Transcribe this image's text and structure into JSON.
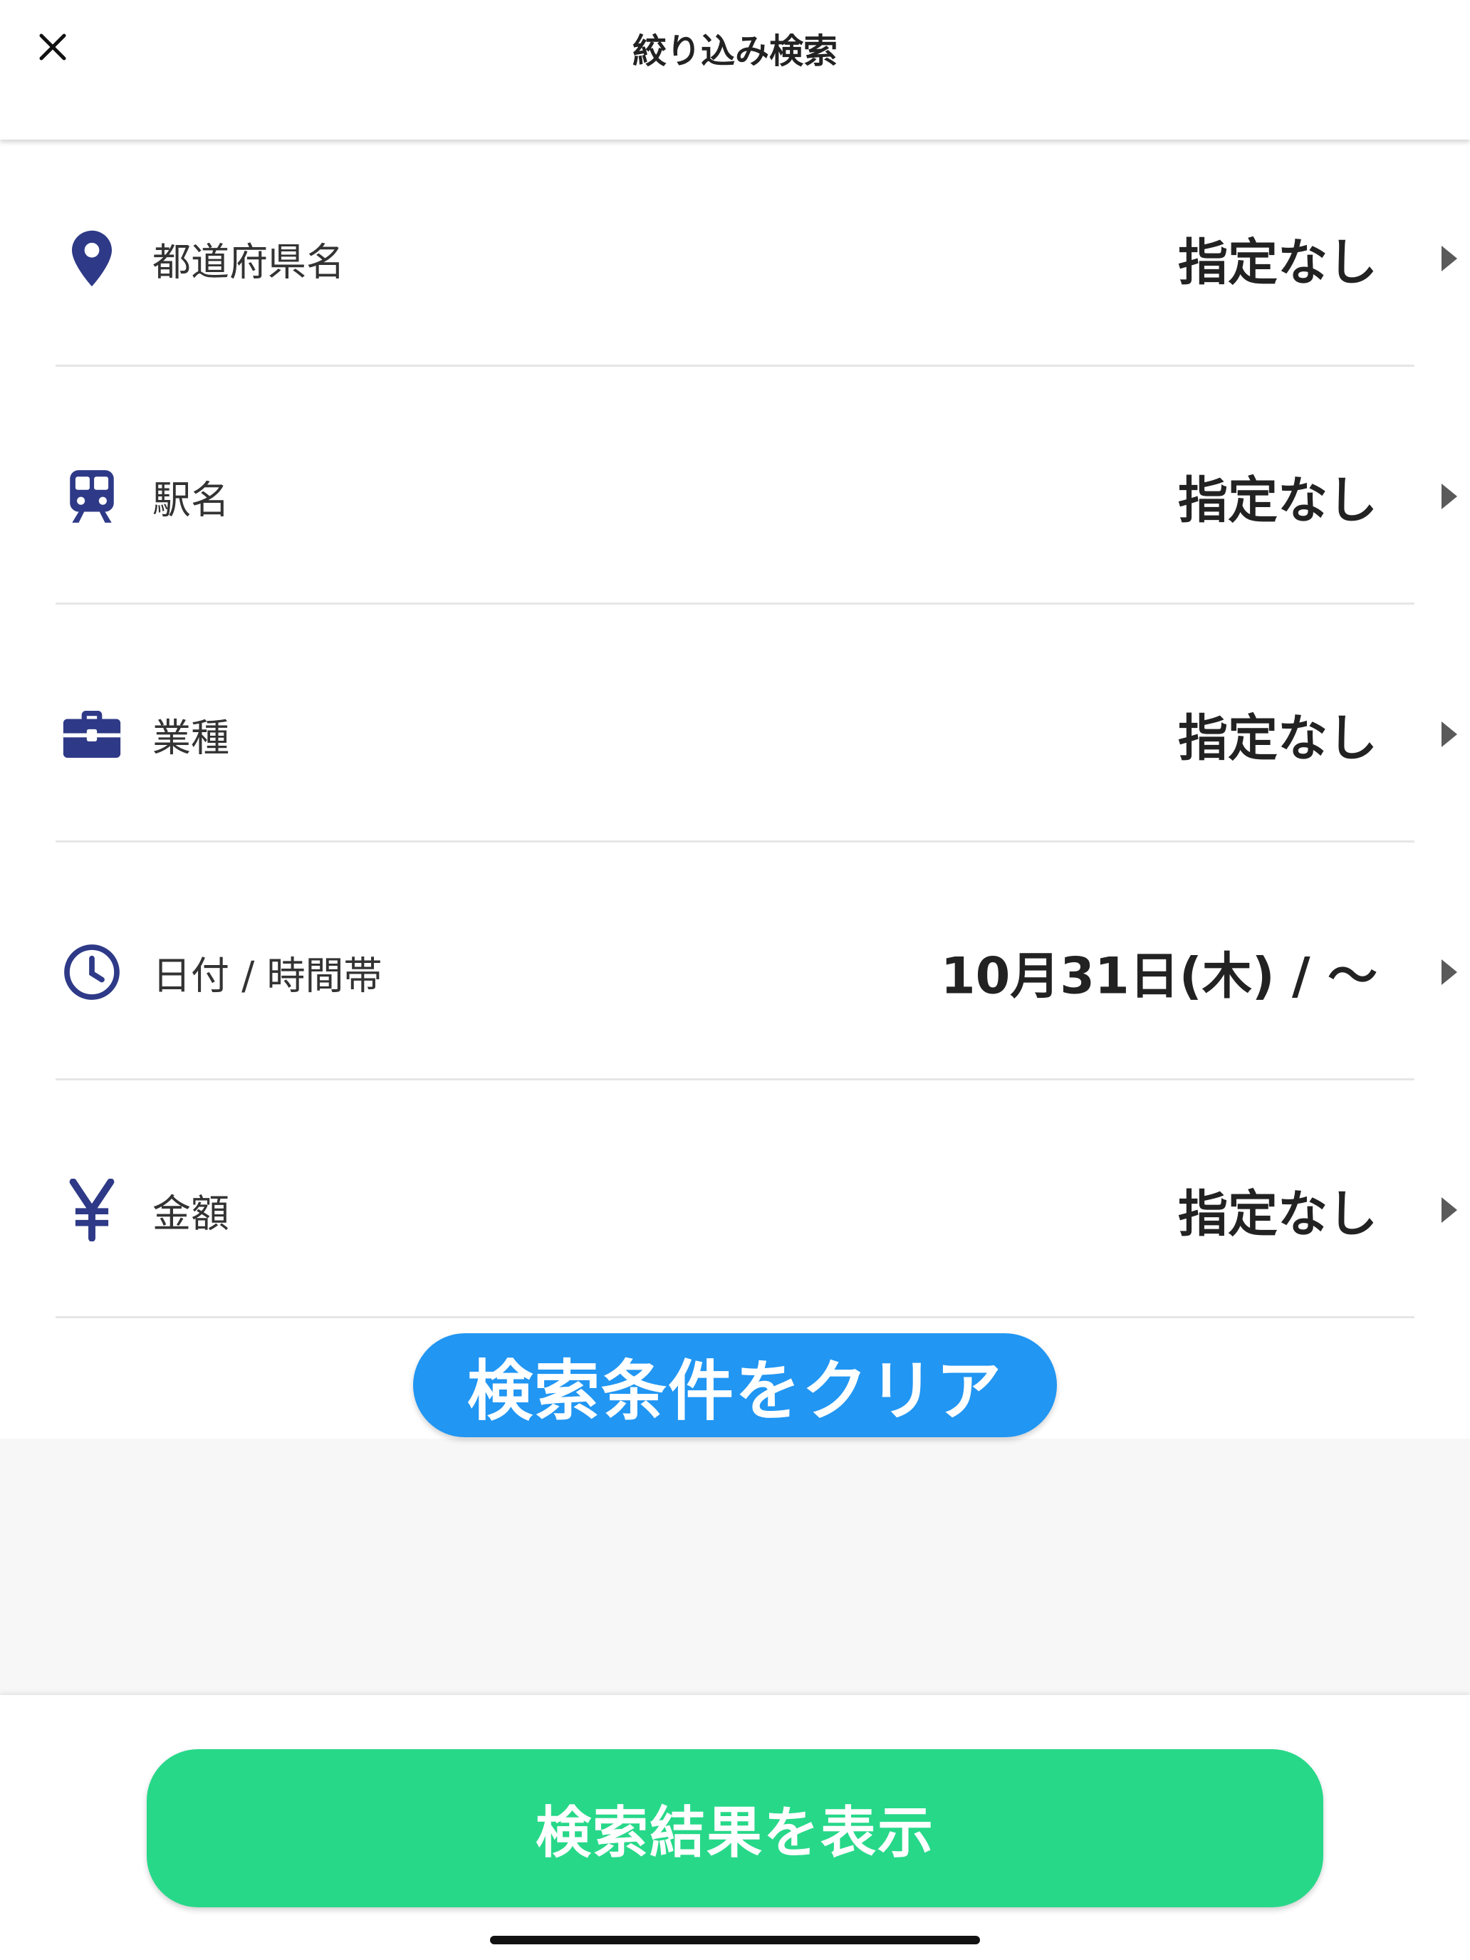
{
  "header": {
    "title": "絞り込み検索",
    "close_icon": "close-icon"
  },
  "filters": [
    {
      "icon": "location-pin-icon",
      "label": "都道府県名",
      "value": "指定なし"
    },
    {
      "icon": "train-icon",
      "label": "駅名",
      "value": "指定なし"
    },
    {
      "icon": "briefcase-icon",
      "label": "業種",
      "value": "指定なし"
    },
    {
      "icon": "clock-icon",
      "label": "日付 / 時間帯",
      "value": "10月31日(木) / 〜"
    },
    {
      "icon": "yen-icon",
      "label": "金額",
      "value": "指定なし"
    }
  ],
  "actions": {
    "clear_label": "検索条件をクリア",
    "show_results_label": "検索結果を表示"
  },
  "colors": {
    "icon": "#2e3a87",
    "clear_button": "#2196f3",
    "show_button": "#27d889"
  }
}
